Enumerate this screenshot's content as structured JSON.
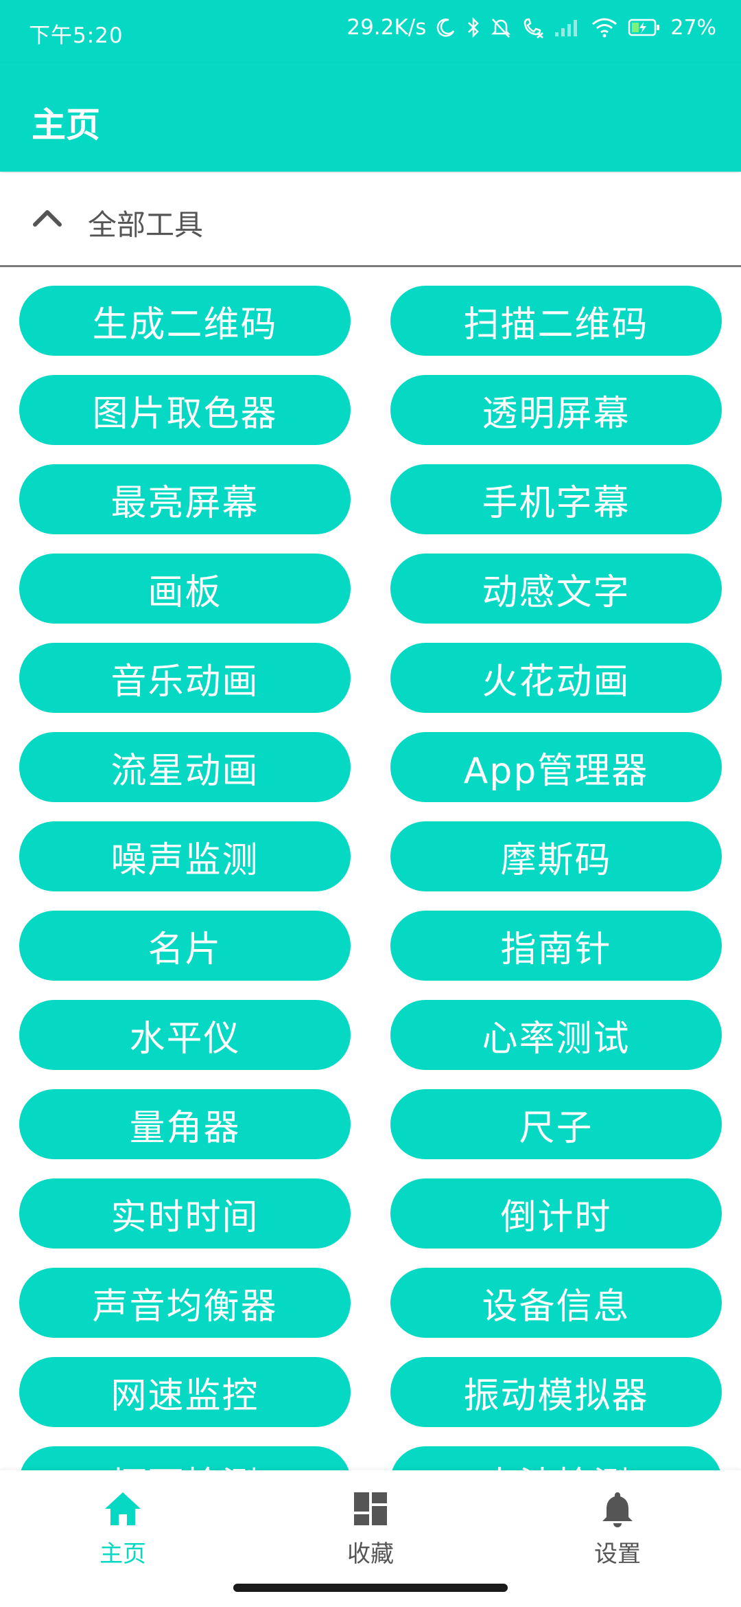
{
  "status_bar": {
    "time": "下午5:20",
    "net_speed": "29.2K/s",
    "battery": "27%",
    "icons": [
      "moon-icon",
      "bluetooth-icon",
      "bell-muted-icon",
      "missed-call-icon",
      "signal-icon",
      "wifi-icon",
      "battery-icon"
    ]
  },
  "app_bar": {
    "title": "主页"
  },
  "section": {
    "title": "全部工具",
    "icon": "chevron-up-icon"
  },
  "tools": [
    "生成二维码",
    "扫描二维码",
    "图片取色器",
    "透明屏幕",
    "最亮屏幕",
    "手机字幕",
    "画板",
    "动感文字",
    "音乐动画",
    "火花动画",
    "流星动画",
    "App管理器",
    "噪声监测",
    "摩斯码",
    "名片",
    "指南针",
    "水平仪",
    "心率测试",
    "量角器",
    "尺子",
    "实时时间",
    "倒计时",
    "声音均衡器",
    "设备信息",
    "网速监控",
    "振动模拟器",
    "坏死检测",
    "电池检测"
  ],
  "bottom_nav": {
    "items": [
      {
        "label": "主页",
        "icon": "home-icon",
        "active": true
      },
      {
        "label": "收藏",
        "icon": "dashboard-icon",
        "active": false
      },
      {
        "label": "设置",
        "icon": "bell-icon",
        "active": false
      }
    ]
  },
  "colors": {
    "accent": "#05d9c3",
    "text_gray": "#555555"
  }
}
